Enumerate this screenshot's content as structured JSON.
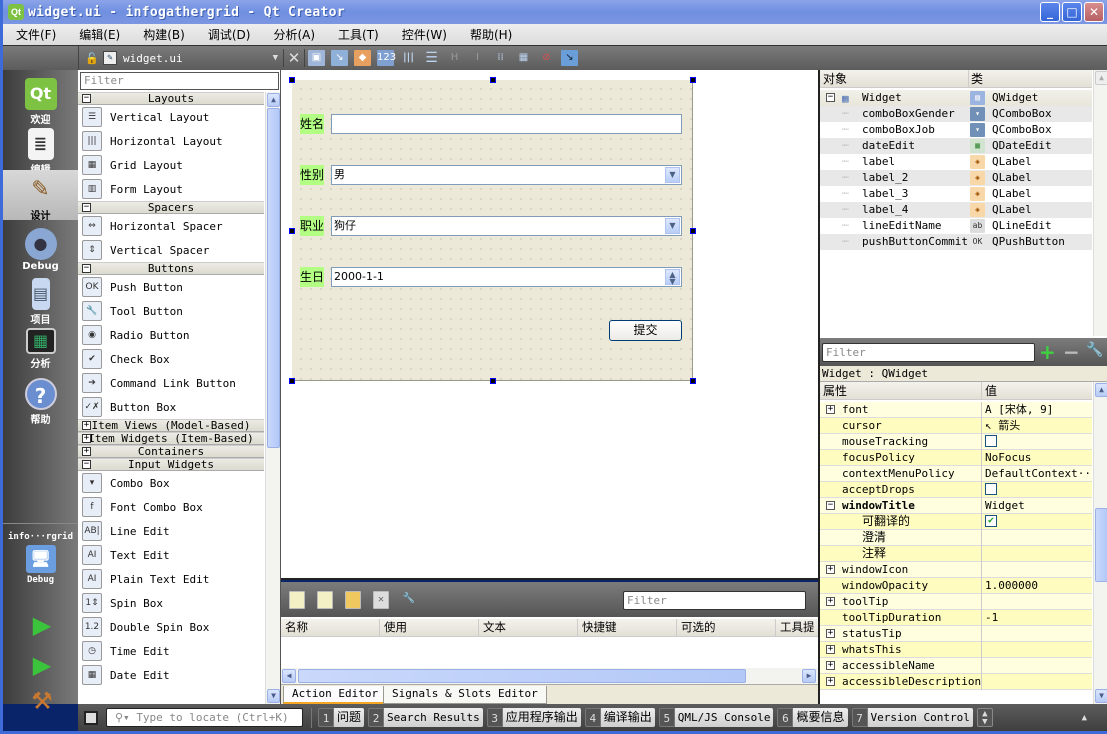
{
  "window": {
    "title": "widget.ui - infogathergrid - Qt Creator",
    "app_icon": "qt-logo-icon",
    "buttons": {
      "minimize": "_",
      "maximize": "□",
      "close": "✕"
    }
  },
  "menubar": [
    "文件(F)",
    "编辑(E)",
    "构建(B)",
    "调试(D)",
    "分析(A)",
    "工具(T)",
    "控件(W)",
    "帮助(H)"
  ],
  "toolbar": {
    "file_name": "widget.ui",
    "close_symbol": "✕",
    "tools": [
      "edit-widgets-icon",
      "edit-signals-slots-icon",
      "edit-buddies-icon",
      "edit-tab-order-icon",
      "layout-horizontal-icon",
      "layout-vertical-icon",
      "splitter-horizontal-icon",
      "splitter-vertical-icon",
      "layout-form-icon",
      "layout-grid-icon",
      "break-layout-icon",
      "adjust-size-icon"
    ]
  },
  "modes": [
    {
      "label": "欢迎",
      "icon": "welcome-icon",
      "glyph": "Qt"
    },
    {
      "label": "编辑",
      "icon": "edit-icon",
      "glyph": "≣"
    },
    {
      "label": "设计",
      "icon": "design-icon",
      "glyph": "✎",
      "active": true
    },
    {
      "label": "Debug",
      "icon": "debug-icon",
      "glyph": "🐞"
    },
    {
      "label": "项目",
      "icon": "projects-icon",
      "glyph": "▤"
    },
    {
      "label": "分析",
      "icon": "analyze-icon",
      "glyph": "▦"
    },
    {
      "label": "帮助",
      "icon": "help-icon",
      "glyph": "?"
    }
  ],
  "project": {
    "name": "info···rgrid",
    "config": "Debug"
  },
  "widget_box": {
    "filter_placeholder": "Filter",
    "sections": [
      {
        "title": "Layouts",
        "expanded": true,
        "items": [
          {
            "label": "Vertical Layout",
            "glyph": "☰"
          },
          {
            "label": "Horizontal Layout",
            "glyph": "|||"
          },
          {
            "label": "Grid Layout",
            "glyph": "▦"
          },
          {
            "label": "Form Layout",
            "glyph": "▥"
          }
        ]
      },
      {
        "title": "Spacers",
        "expanded": true,
        "items": [
          {
            "label": "Horizontal Spacer",
            "glyph": "⇔"
          },
          {
            "label": "Vertical Spacer",
            "glyph": "⇕"
          }
        ]
      },
      {
        "title": "Buttons",
        "expanded": true,
        "items": [
          {
            "label": "Push Button",
            "glyph": "OK"
          },
          {
            "label": "Tool Button",
            "glyph": "🔧"
          },
          {
            "label": "Radio Button",
            "glyph": "◉"
          },
          {
            "label": "Check Box",
            "glyph": "✔"
          },
          {
            "label": "Command Link Button",
            "glyph": "➔"
          },
          {
            "label": "Button Box",
            "glyph": "✓✗"
          }
        ]
      },
      {
        "title": "Item Views (Model-Based)",
        "expanded": false,
        "items": []
      },
      {
        "title": "Item Widgets (Item-Based)",
        "expanded": false,
        "items": []
      },
      {
        "title": "Containers",
        "expanded": false,
        "items": []
      },
      {
        "title": "Input Widgets",
        "expanded": true,
        "items": [
          {
            "label": "Combo Box",
            "glyph": "▾"
          },
          {
            "label": "Font Combo Box",
            "glyph": "f"
          },
          {
            "label": "Line Edit",
            "glyph": "AB|"
          },
          {
            "label": "Text Edit",
            "glyph": "AI"
          },
          {
            "label": "Plain Text Edit",
            "glyph": "AI"
          },
          {
            "label": "Spin Box",
            "glyph": "1⇕"
          },
          {
            "label": "Double Spin Box",
            "glyph": "1.2"
          },
          {
            "label": "Time Edit",
            "glyph": "◷"
          },
          {
            "label": "Date Edit",
            "glyph": "▦"
          }
        ]
      }
    ]
  },
  "form": {
    "rows": [
      {
        "label": "姓名",
        "type": "lineedit",
        "value": ""
      },
      {
        "label": "性别",
        "type": "combobox",
        "value": "男"
      },
      {
        "label": "职业",
        "type": "combobox",
        "value": "狗仔"
      },
      {
        "label": "生日",
        "type": "dateedit",
        "value": "2000-1-1"
      }
    ],
    "submit_label": "提交"
  },
  "action_editor": {
    "filter_placeholder": "Filter",
    "columns": [
      "名称",
      "使用",
      "文本",
      "快捷键",
      "可选的",
      "工具提"
    ],
    "tabs": [
      {
        "label": "Action Editor",
        "active": true
      },
      {
        "label": "Signals & Slots Editor",
        "active": false
      }
    ]
  },
  "object_inspector": {
    "headers": {
      "object": "对象",
      "class": "类"
    },
    "rows": [
      {
        "name": "Widget",
        "class": "QWidget",
        "icon": "qwidget-icon",
        "root": true
      },
      {
        "name": "comboBoxGender",
        "class": "QComboBox",
        "icon": "combobox-icon"
      },
      {
        "name": "comboBoxJob",
        "class": "QComboBox",
        "icon": "combobox-icon"
      },
      {
        "name": "dateEdit",
        "class": "QDateEdit",
        "icon": "dateedit-icon"
      },
      {
        "name": "label",
        "class": "QLabel",
        "icon": "label-icon"
      },
      {
        "name": "label_2",
        "class": "QLabel",
        "icon": "label-icon"
      },
      {
        "name": "label_3",
        "class": "QLabel",
        "icon": "label-icon"
      },
      {
        "name": "label_4",
        "class": "QLabel",
        "icon": "label-icon"
      },
      {
        "name": "lineEditName",
        "class": "QLineEdit",
        "icon": "lineedit-icon"
      },
      {
        "name": "pushButtonCommit",
        "class": "QPushButton",
        "icon": "pushbutton-icon"
      }
    ]
  },
  "property_editor": {
    "filter_placeholder": "Filter",
    "class_label": "Widget : QWidget",
    "headers": {
      "property": "属性",
      "value": "值"
    },
    "rows": [
      {
        "name": "font",
        "value": "A  [宋体, 9]",
        "expandable": true
      },
      {
        "name": "cursor",
        "value": "↖  箭头"
      },
      {
        "name": "mouseTracking",
        "checkbox": false
      },
      {
        "name": "focusPolicy",
        "value": "NoFocus"
      },
      {
        "name": "contextMenuPolicy",
        "value": "DefaultContext···"
      },
      {
        "name": "acceptDrops",
        "checkbox": false
      },
      {
        "name": "windowTitle",
        "value": "Widget",
        "expandable": true,
        "expanded": true,
        "bold": true
      },
      {
        "name": "可翻译的",
        "checkbox": true,
        "sub": true
      },
      {
        "name": "澄清",
        "value": "",
        "sub": true
      },
      {
        "name": "注释",
        "value": "",
        "sub": true
      },
      {
        "name": "windowIcon",
        "value": "",
        "expandable": true
      },
      {
        "name": "windowOpacity",
        "value": "1.000000"
      },
      {
        "name": "toolTip",
        "value": "",
        "expandable": true
      },
      {
        "name": "toolTipDuration",
        "value": "-1"
      },
      {
        "name": "statusTip",
        "value": "",
        "expandable": true
      },
      {
        "name": "whatsThis",
        "value": "",
        "expandable": true
      },
      {
        "name": "accessibleName",
        "value": "",
        "expandable": true
      },
      {
        "name": "accessibleDescription",
        "value": "",
        "expandable": true
      }
    ]
  },
  "statusbar": {
    "locate_placeholder": "Type to locate (Ctrl+K)",
    "panes": [
      {
        "num": "1",
        "label": "问题"
      },
      {
        "num": "2",
        "label": "Search Results"
      },
      {
        "num": "3",
        "label": "应用程序输出"
      },
      {
        "num": "4",
        "label": "编译输出"
      },
      {
        "num": "5",
        "label": "QML/JS Console"
      },
      {
        "num": "6",
        "label": "概要信息"
      },
      {
        "num": "7",
        "label": "Version Control"
      }
    ]
  }
}
